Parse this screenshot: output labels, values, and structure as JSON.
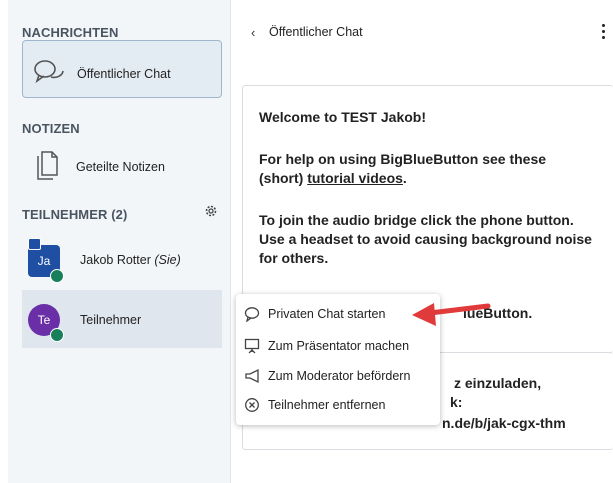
{
  "sidebar": {
    "messages_title": "NACHRICHTEN",
    "public_chat_label": "Öffentlicher Chat",
    "notes_title": "NOTIZEN",
    "shared_notes_label": "Geteilte Notizen",
    "participants_title": "TEILNEHMER (2)",
    "users": [
      {
        "initials": "Ja",
        "name": "Jakob Rotter",
        "suffix": "(Sie)"
      },
      {
        "initials": "Te",
        "name": "Teilnehmer",
        "suffix": ""
      }
    ]
  },
  "chat": {
    "back_icon": "chevron-left-icon",
    "title": "Öffentlicher Chat",
    "welcome_prefix": "Welcome to ",
    "welcome_name": "TEST Jakob",
    "welcome_suffix": "!",
    "help_line1": "For help on using BigBlueButton see these",
    "help_line2_pre": "(short) ",
    "help_link": "tutorial videos",
    "help_line2_post": ".",
    "audio_line1": "To join the audio bridge click the phone button.",
    "audio_line2": "Use a headset to avoid causing background noise",
    "audio_line3": "for others.",
    "partial_line1": "lueButton.",
    "partial_line2": "z einzuladen,",
    "partial_line3": "k:",
    "partial_line4": "n.de/b/jak-cgx-thm"
  },
  "context_menu": {
    "items": [
      {
        "icon": "chat-bubble-icon",
        "label": "Privaten Chat starten"
      },
      {
        "icon": "presentation-icon",
        "label": "Zum Präsentator machen"
      },
      {
        "icon": "megaphone-icon",
        "label": "Zum Moderator befördern"
      },
      {
        "icon": "remove-circle-icon",
        "label": "Teilnehmer entfernen"
      }
    ]
  },
  "colors": {
    "accent_blue": "#1e4fa3",
    "avatar_purple": "#6a2ea6",
    "voice_green": "#17805b",
    "arrow_red": "#e03a3a"
  }
}
